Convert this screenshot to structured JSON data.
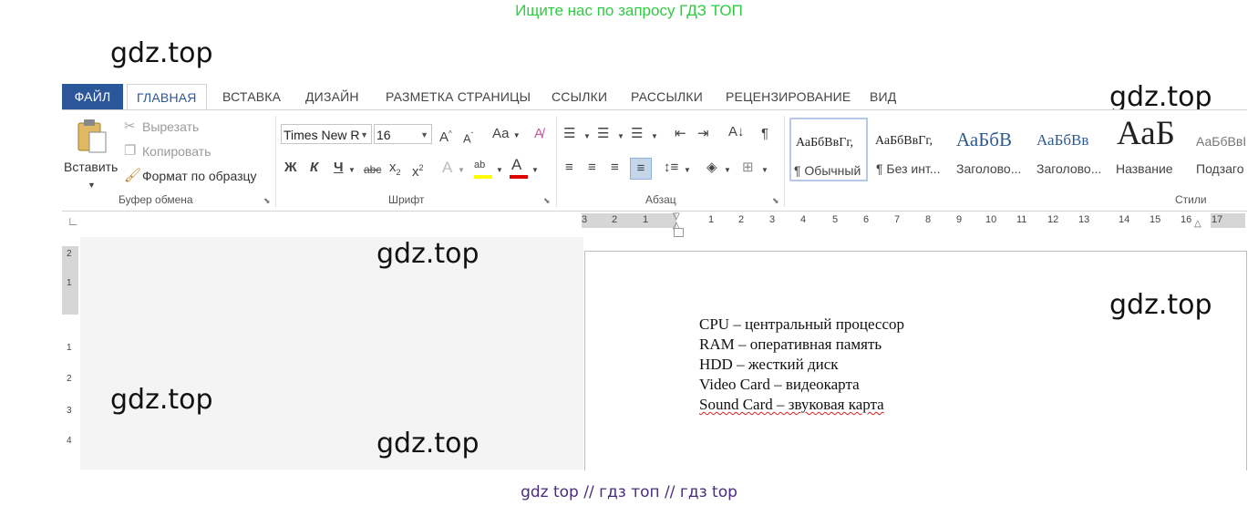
{
  "top_banner": "Ищите нас по запросу ГДЗ ТОП",
  "watermarks": {
    "w1": "gdz.top",
    "w2": "gdz.top",
    "w3": "gdz.top",
    "w4": "gdz.top",
    "w5": "gdz.top",
    "w6": "gdz.top"
  },
  "bottom_banner": "gdz top  //  гдз топ  //  гдз top",
  "tabs": {
    "file": "ФАЙЛ",
    "home": "ГЛАВНАЯ",
    "insert": "ВСТАВКА",
    "design": "ДИЗАЙН",
    "layout": "РАЗМЕТКА СТРАНИЦЫ",
    "references": "ССЫЛКИ",
    "mailings": "РАССЫЛКИ",
    "review": "РЕЦЕНЗИРОВАНИЕ",
    "view": "ВИД"
  },
  "clipboard": {
    "paste": "Вставить",
    "cut": "Вырезать",
    "copy": "Копировать",
    "format_painter": "Формат по образцу",
    "label": "Буфер обмена"
  },
  "font": {
    "family": "Times New R",
    "size": "16",
    "change_case": "Аа",
    "bold": "Ж",
    "italic": "К",
    "underline": "Ч",
    "strike": "abc",
    "label": "Шрифт"
  },
  "paragraph": {
    "label": "Абзац"
  },
  "styles": {
    "label": "Стили",
    "items": [
      {
        "sample": "АаБбВвГг,",
        "name": "¶ Обычный"
      },
      {
        "sample": "АаБбВвГг,",
        "name": "¶ Без инт..."
      },
      {
        "sample": "АаБбВ",
        "name": "Заголово..."
      },
      {
        "sample": "АаБбВв",
        "name": "Заголово..."
      },
      {
        "sample": "АаБ",
        "name": "Название"
      },
      {
        "sample": "АаБбВвІ",
        "name": "Подзаго"
      }
    ]
  },
  "ruler": {
    "h_ticks": [
      "3",
      "2",
      "1",
      "1",
      "2",
      "3",
      "4",
      "5",
      "6",
      "7",
      "8",
      "9",
      "10",
      "11",
      "12",
      "13",
      "14",
      "15",
      "16",
      "17"
    ],
    "v_ticks": [
      "2",
      "1",
      "1",
      "2",
      "3",
      "4"
    ]
  },
  "document": {
    "lines": [
      "CPU – центральный процессор",
      "RAM – оперативная память",
      "HDD – жесткий диск",
      "Video Card – видеокарта",
      "Sound Card – звуковая карта"
    ]
  },
  "colors": {
    "file_tab": "#2b579a",
    "banner_top": "#2ecc40",
    "banner_bottom": "#4b2b7e",
    "highlight": "#ffff00",
    "font_color": "#e00000"
  }
}
